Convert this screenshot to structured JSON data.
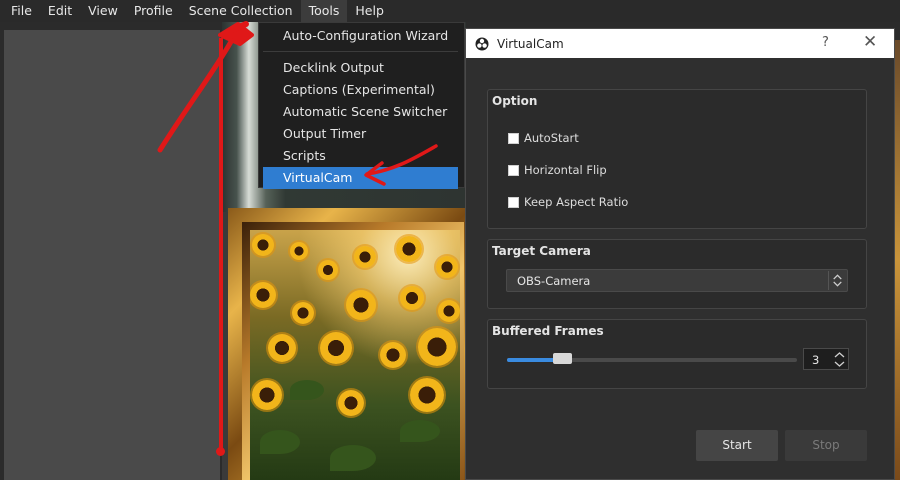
{
  "menubar": {
    "items": [
      "File",
      "Edit",
      "View",
      "Profile",
      "Scene Collection",
      "Tools",
      "Help"
    ]
  },
  "tools_menu": {
    "items": [
      "Auto-Configuration Wizard",
      "Decklink Output",
      "Captions (Experimental)",
      "Automatic Scene Switcher",
      "Output Timer",
      "Scripts",
      "VirtualCam"
    ],
    "selected": "VirtualCam"
  },
  "dialog": {
    "title": "VirtualCam",
    "help_glyph": "?",
    "close_glyph": "✕",
    "option": {
      "title": "Option",
      "checkboxes": [
        {
          "label": "AutoStart",
          "checked": false
        },
        {
          "label": "Horizontal Flip",
          "checked": false
        },
        {
          "label": "Keep Aspect Ratio",
          "checked": false
        }
      ]
    },
    "target_camera": {
      "title": "Target Camera",
      "value": "OBS-Camera"
    },
    "buffered_frames": {
      "title": "Buffered Frames",
      "value": "3",
      "slider_fraction": 0.13
    },
    "start_label": "Start",
    "stop_label": "Stop"
  },
  "colors": {
    "accent": "#2f7dd1",
    "annotation": "#e01818"
  }
}
